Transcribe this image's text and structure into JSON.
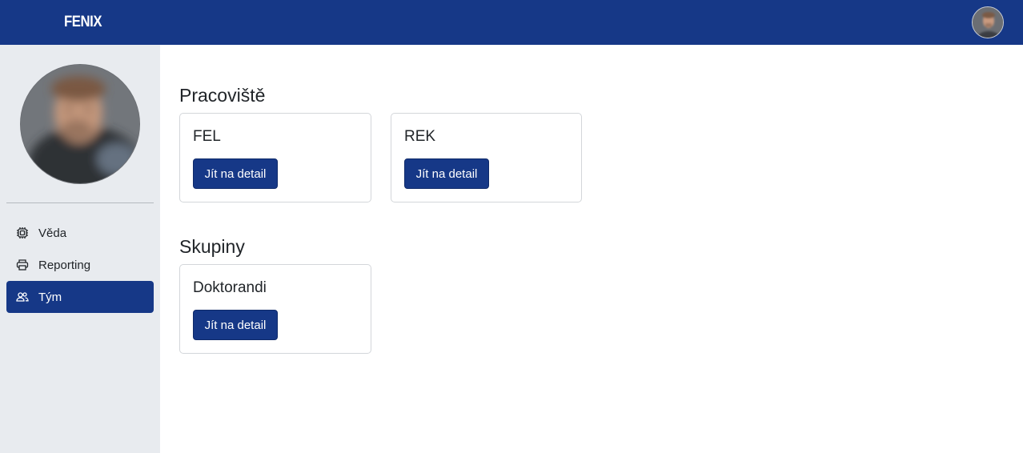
{
  "app": {
    "brand": "FENIX"
  },
  "sidebar": {
    "items": [
      {
        "label": "Věda",
        "icon": "cpu-icon",
        "active": false
      },
      {
        "label": "Reporting",
        "icon": "printer-icon",
        "active": false
      },
      {
        "label": "Tým",
        "icon": "people-icon",
        "active": true
      }
    ]
  },
  "main": {
    "workplaces": {
      "title": "Pracoviště",
      "cards": [
        {
          "name": "FEL",
          "button": "Jít na detail"
        },
        {
          "name": "REK",
          "button": "Jít na detail"
        }
      ]
    },
    "groups": {
      "title": "Skupiny",
      "cards": [
        {
          "name": "Doktorandi",
          "button": "Jít na detail"
        }
      ]
    }
  },
  "colors": {
    "primary": "#163887",
    "sidebar_bg": "#e8ebef",
    "card_border": "#d3d6da"
  }
}
